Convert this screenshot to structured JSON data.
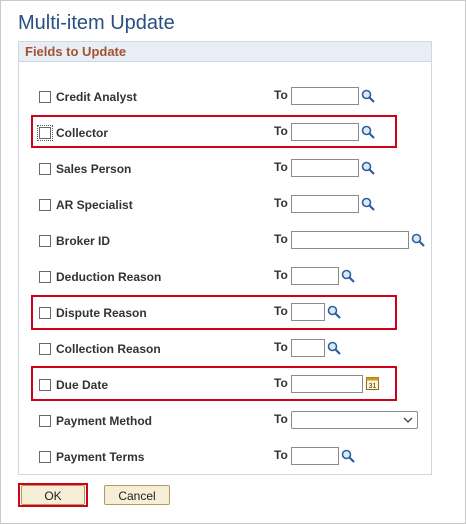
{
  "page_title": "Multi-item Update",
  "group_title": "Fields to Update",
  "to_label": "To",
  "fields": [
    {
      "label": "Credit Analyst",
      "value": ""
    },
    {
      "label": "Collector",
      "value": ""
    },
    {
      "label": "Sales Person",
      "value": ""
    },
    {
      "label": "AR Specialist",
      "value": ""
    },
    {
      "label": "Broker ID",
      "value": ""
    },
    {
      "label": "Deduction Reason",
      "value": ""
    },
    {
      "label": "Dispute Reason",
      "value": ""
    },
    {
      "label": "Collection Reason",
      "value": ""
    },
    {
      "label": "Due Date",
      "value": ""
    },
    {
      "label": "Payment Method",
      "value": ""
    },
    {
      "label": "Payment Terms",
      "value": ""
    }
  ],
  "buttons": {
    "ok": "OK",
    "cancel": "Cancel"
  },
  "colors": {
    "title": "#294f82",
    "group_header_text": "#a5512e",
    "highlight": "#d0021b",
    "button_bg": "#f6eed7"
  },
  "icons": {
    "lookup": "magnifier-icon",
    "calendar": "calendar-icon",
    "dropdown": "chevron-down-icon"
  }
}
